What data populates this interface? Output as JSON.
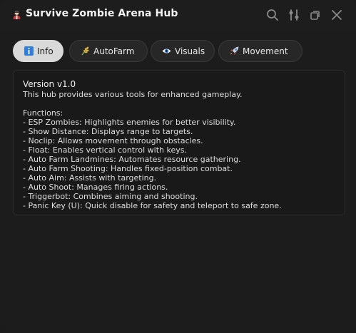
{
  "window": {
    "title": "Survive Zombie Arena Hub"
  },
  "tabs": [
    {
      "label": "Info",
      "icon": "info-icon"
    },
    {
      "label": "AutoFarm",
      "icon": "wheat-icon"
    },
    {
      "label": "Visuals",
      "icon": "eye-icon"
    },
    {
      "label": "Movement",
      "icon": "rocket-icon"
    }
  ],
  "info": {
    "version": "Version v1.0",
    "description": "This hub provides various tools for enhanced gameplay.",
    "functions_heading": "Functions:",
    "functions": [
      "- ESP Zombies: Highlights enemies for better visibility.",
      "- Show Distance: Displays range to targets.",
      "- Noclip: Allows movement through obstacles.",
      "- Float: Enables vertical control with keys.",
      "- Auto Farm Landmines: Automates resource gathering.",
      "- Auto Farm Shooting: Handles fixed-position combat.",
      "- Auto Aim: Assists with targeting.",
      "- Auto Shoot: Manages firing actions.",
      "- Triggerbot: Combines aiming and shooting.",
      "- Panic Key (U): Quick disable for safety and teleport to safe zone."
    ]
  },
  "colors": {
    "background": "#1c1c1c",
    "active_tab": "#d9d9d9",
    "info_icon": "#2f7fd8"
  }
}
